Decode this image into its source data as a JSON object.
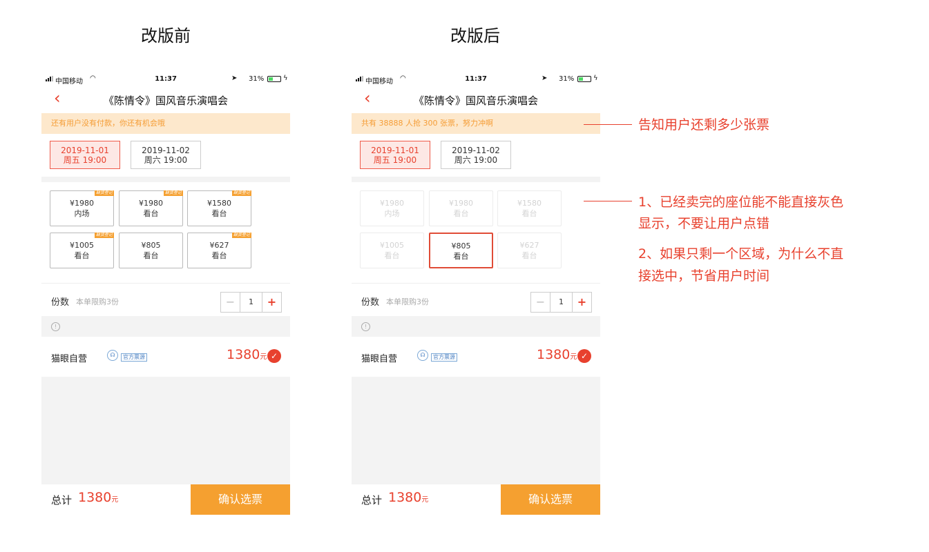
{
  "headings": {
    "before": "改版前",
    "after": "改版后"
  },
  "statusbar": {
    "carrier": "中国移动",
    "time": "11:37",
    "battery": "31%"
  },
  "colors": {
    "accent": "#e8412e",
    "orange": "#f5a030",
    "notice_bg": "#fde8cc"
  },
  "icons": [
    "back-chevron-icon",
    "wifi-icon",
    "location-icon",
    "battery-icon",
    "info-icon",
    "customer-service-icon",
    "check-icon"
  ],
  "before": {
    "title": "《陈情令》国风音乐演唱会",
    "notice": "还有用户没有付款，你还有机会哦",
    "dates": [
      {
        "date": "2019-11-01",
        "time": "周五 19:00"
      },
      {
        "date": "2019-11-02",
        "time": "周六 19:00"
      }
    ],
    "seats": [
      {
        "price": "¥1980",
        "area": "内场",
        "tag": "缺货登记"
      },
      {
        "price": "¥1980",
        "area": "看台",
        "tag": "缺货登记"
      },
      {
        "price": "¥1580",
        "area": "看台",
        "tag": "缺货登记"
      },
      {
        "price": "¥1005",
        "area": "看台",
        "tag": "缺货登记"
      },
      {
        "price": "¥805",
        "area": "看台"
      },
      {
        "price": "¥627",
        "area": "看台",
        "tag": "缺货登记"
      }
    ],
    "qty_label": "份数",
    "qty_limit": "本单限购3份",
    "qty_value": "1",
    "minus": "−",
    "plus": "+",
    "vendor": "猫眼自营",
    "vendor_badge": "官方票源",
    "price": "1380",
    "yuan": "元",
    "total_label": "总计",
    "total_price": "1380",
    "confirm": "确认选票"
  },
  "after": {
    "title": "《陈情令》国风音乐演唱会",
    "notice": "共有 38888 人抢 300 张票，努力冲啊",
    "dates": [
      {
        "date": "2019-11-01",
        "time": "周五 19:00"
      },
      {
        "date": "2019-11-02",
        "time": "周六 19:00"
      }
    ],
    "seats": [
      {
        "price": "¥1980",
        "area": "内场",
        "status": "sold-out"
      },
      {
        "price": "¥1980",
        "area": "看台",
        "status": "sold-out"
      },
      {
        "price": "¥1580",
        "area": "看台",
        "status": "sold-out"
      },
      {
        "price": "¥1005",
        "area": "看台",
        "status": "sold-out"
      },
      {
        "price": "¥805",
        "area": "看台",
        "status": "selected"
      },
      {
        "price": "¥627",
        "area": "看台",
        "status": "sold-out"
      }
    ],
    "qty_label": "份数",
    "qty_limit": "本单限购3份",
    "qty_value": "1",
    "minus": "−",
    "plus": "+",
    "vendor": "猫眼自营",
    "vendor_badge": "官方票源",
    "price": "1380",
    "yuan": "元",
    "total_label": "总计",
    "total_price": "1380",
    "confirm": "确认选票"
  },
  "annotations": {
    "notice": "告知用户还剩多少张票",
    "seats_1_line1": "1、已经卖完的座位能不能直接灰色",
    "seats_1_line2": "显示，不要让用户点错",
    "seats_2_line1": "2、如果只剩一个区域，为什么不直",
    "seats_2_line2": "接选中，节省用户时间"
  }
}
